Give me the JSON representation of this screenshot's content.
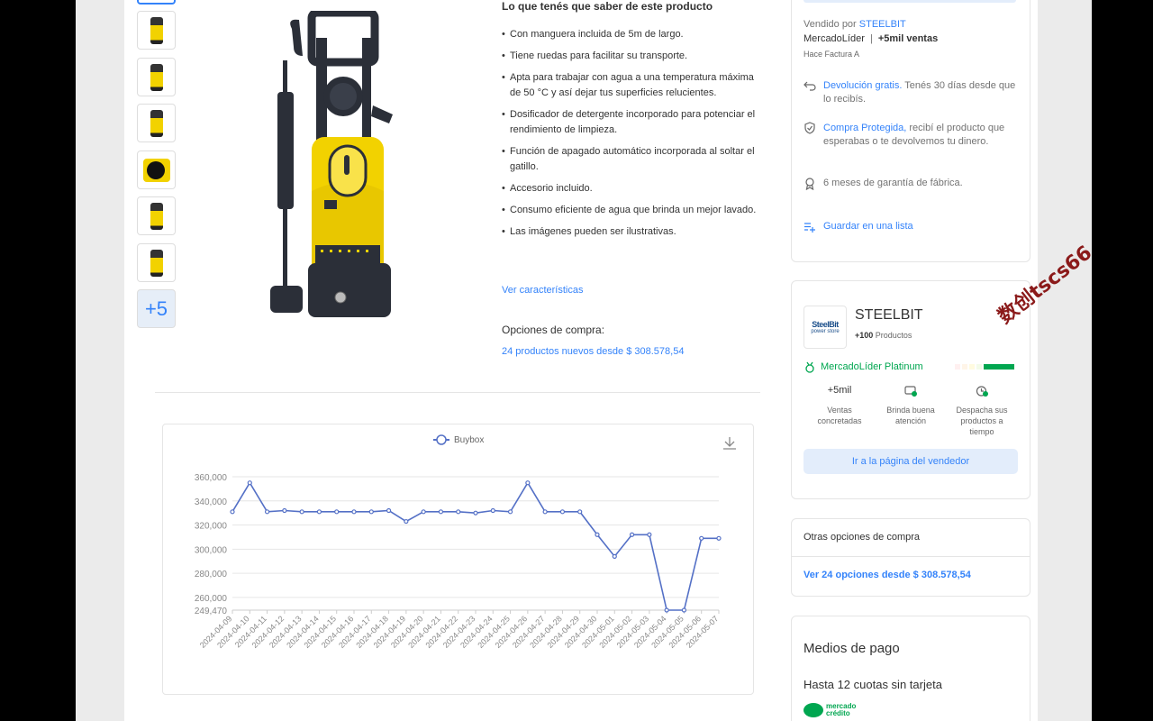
{
  "description": {
    "title": "Lo que tenés que saber de este producto",
    "bullets": [
      "Con manguera incluida de 5m de largo.",
      "Tiene ruedas para facilitar su transporte.",
      "Apta para trabajar con agua a una temperatura máxima de 50 °C y así dejar tus superficies relucientes.",
      "Dosificador de detergente incorporado para potenciar el rendimiento de limpieza.",
      "Función de apagado automático incorporada al soltar el gatillo.",
      "Accesorio incluido.",
      "Consumo eficiente de agua que brinda un mejor lavado.",
      "Las imágenes pueden ser ilustrativas."
    ],
    "features_link": "Ver características",
    "purchase_options_label": "Opciones de compra:",
    "new_products_link": "24 productos nuevos desde $ 308.578,54"
  },
  "gallery": {
    "more_label": "+5"
  },
  "chart_data": {
    "type": "line",
    "legend": [
      "Buybox"
    ],
    "x": [
      "2024-04-09",
      "2024-04-10",
      "2024-04-11",
      "2024-04-12",
      "2024-04-13",
      "2024-04-14",
      "2024-04-15",
      "2024-04-16",
      "2024-04-17",
      "2024-04-18",
      "2024-04-19",
      "2024-04-20",
      "2024-04-21",
      "2024-04-22",
      "2024-04-23",
      "2024-04-24",
      "2024-04-25",
      "2024-04-26",
      "2024-04-27",
      "2024-04-28",
      "2024-04-29",
      "2024-04-30",
      "2024-05-01",
      "2024-05-02",
      "2024-05-03",
      "2024-05-04",
      "2024-05-05",
      "2024-05-06",
      "2024-05-07"
    ],
    "series": [
      {
        "name": "Buybox",
        "values": [
          331000,
          355000,
          331000,
          332000,
          331000,
          331000,
          331000,
          331000,
          331000,
          332000,
          323000,
          331000,
          331000,
          331000,
          330000,
          332000,
          331000,
          355000,
          331000,
          331000,
          331000,
          312000,
          294000,
          312000,
          312000,
          249470,
          249470,
          309000
        ]
      }
    ],
    "yticks": [
      "360,000",
      "340,000",
      "320,000",
      "300,000",
      "280,000",
      "260,000",
      "249,470"
    ],
    "ylim": [
      249470,
      360000
    ],
    "grid": true,
    "legend_position": "top-center"
  },
  "seller_box": {
    "sold_by_prefix": "Vendido por",
    "seller_name": "STEELBIT",
    "leader_label": "MercadoLíder",
    "separator": "|",
    "sales_label": "+5mil ventas",
    "invoice": "Hace Factura A",
    "return_link": "Devolución gratis.",
    "return_text": "Tenés 30 días desde que lo recibís.",
    "protected_link": "Compra Protegida,",
    "protected_text": "recibí el producto que esperabas o te devolvemos tu dinero.",
    "warranty": "6 meses de garantía de fábrica.",
    "save_list": "Guardar en una lista"
  },
  "seller_card": {
    "name": "STEELBIT",
    "logo_line1": "SteelBit",
    "logo_line2": "power store",
    "products_count": "+100",
    "products_label": "Productos",
    "badge": "MercadoLíder Platinum",
    "stats": [
      {
        "value": "+5mil",
        "label": "Ventas concretadas"
      },
      {
        "value": "",
        "label": "Brinda buena atención"
      },
      {
        "value": "",
        "label": "Despacha sus productos a tiempo"
      }
    ],
    "button": "Ir a la página del vendedor",
    "reputation_colors": [
      "#fff0f0",
      "#fff5e8",
      "#fffbe0",
      "#f3fbe9",
      "#00a650"
    ]
  },
  "other_options": {
    "title": "Otras opciones de compra",
    "link": "Ver 24 opciones desde $ 308.578,54"
  },
  "payment": {
    "title": "Medios de pago",
    "installments": "Hasta 12 cuotas sin tarjeta",
    "logo_line1": "mercado",
    "logo_line2": "crédito"
  },
  "watermark": "数创tscs66"
}
